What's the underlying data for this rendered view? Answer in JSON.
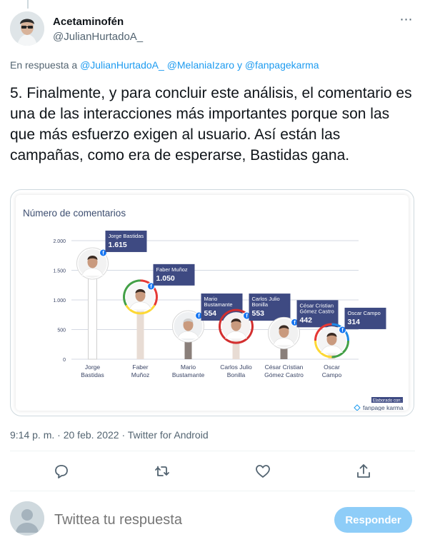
{
  "author": {
    "display_name": "Acetaminofén",
    "handle": "@JulianHurtadoA_"
  },
  "more_icon": "⋯",
  "reply_to": {
    "prefix": "En respuesta a",
    "mention1": "@JulianHurtadoA_",
    "mention2": "@MelaniaIzaro",
    "conj": "y",
    "mention3": "@fanpagekarma"
  },
  "tweet": {
    "text": "5. Finalmente, y para concluir este análisis, el comentario es una de las interacciones más importantes porque son las que más esfuerzo exigen al usuario. Así están las campañas, como era de esperarse, Bastidas gana."
  },
  "meta": {
    "time": "9:14 p. m.",
    "date": "20 feb. 2022",
    "source": "Twitter for Android",
    "separator": "·"
  },
  "actions": {
    "reply": "reply-icon",
    "retweet": "retweet-icon",
    "like": "like-icon",
    "share": "share-icon"
  },
  "reply_box": {
    "placeholder": "Twittea tu respuesta",
    "button_label": "Responder"
  },
  "colors": {
    "accent": "#1d9bf0",
    "chart_bar": "#e8dcd4",
    "chart_label_bg": "#3e4a82",
    "chart_title": "#3d4e70",
    "facebook": "#1877f2"
  },
  "chart_data": {
    "type": "bar",
    "title": "Número de comentarios",
    "yticks": [
      "0",
      "500",
      "1.000",
      "1.500",
      "2.000"
    ],
    "ylim": [
      0,
      2000
    ],
    "grid": true,
    "categories": [
      {
        "label1": "Jorge",
        "label2": "Bastidas",
        "name1": "Jorge Bastidas",
        "name2": "",
        "value_label": "1.615",
        "value": 1615
      },
      {
        "label1": "Faber",
        "label2": "Muñoz",
        "name1": "Faber Muñoz",
        "name2": "",
        "value_label": "1.050",
        "value": 1050
      },
      {
        "label1": "Mario",
        "label2": "Bustamante",
        "name1": "Mario",
        "name2": "Bustamante",
        "value_label": "554",
        "value": 554
      },
      {
        "label1": "Carlos Julio",
        "label2": "Bonilla",
        "name1": "Carlos Julio",
        "name2": "Bonilla",
        "value_label": "553",
        "value": 553
      },
      {
        "label1": "César Cristian",
        "label2": "Gómez Castro",
        "name1": "César Cristian",
        "name2": "Gómez Castro",
        "value_label": "442",
        "value": 442
      },
      {
        "label1": "Oscar",
        "label2": "Campo",
        "name1": "Oscar Campo",
        "name2": "",
        "value_label": "314",
        "value": 314
      }
    ],
    "credit": {
      "line1": "Elaborado con:",
      "line2": "fanpage karma"
    }
  }
}
